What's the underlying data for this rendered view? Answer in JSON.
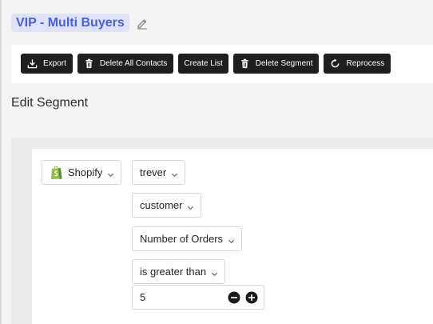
{
  "segment": {
    "title": "VIP - Multi Buyers"
  },
  "toolbar": {
    "export_label": "Export",
    "delete_contacts_label": "Delete All Contacts",
    "create_list_label": "Create List",
    "delete_segment_label": "Delete Segment",
    "reprocess_label": "Reprocess"
  },
  "section": {
    "heading": "Edit Segment"
  },
  "filter": {
    "source": "Shopify",
    "store": "trever",
    "entity": "customer",
    "field": "Number of Orders",
    "operator": "is greater than",
    "value": "5"
  },
  "colors": {
    "title_bg": "#dfe3fa",
    "title_text": "#4a5ee8",
    "button_bg": "#1f1f1f",
    "shopify_green": "#95bf47"
  }
}
